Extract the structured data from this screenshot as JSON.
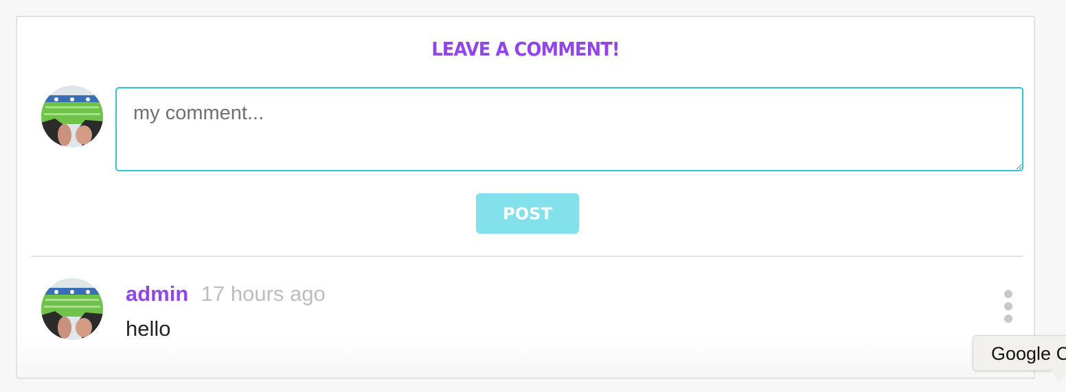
{
  "compose": {
    "heading": "LEAVE A COMMENT!",
    "placeholder": "my comment...",
    "value": "",
    "post_label": "POST"
  },
  "comments": [
    {
      "author": "admin",
      "time": "17 hours ago",
      "text": "hello",
      "menu_icon": "vertical-ellipsis-icon"
    }
  ],
  "tooltip": {
    "text": "Google C"
  },
  "colors": {
    "accent": "#9046e8",
    "input_border": "#2cc6d2",
    "button": "#82e1ea",
    "muted": "#bdbdbd"
  }
}
